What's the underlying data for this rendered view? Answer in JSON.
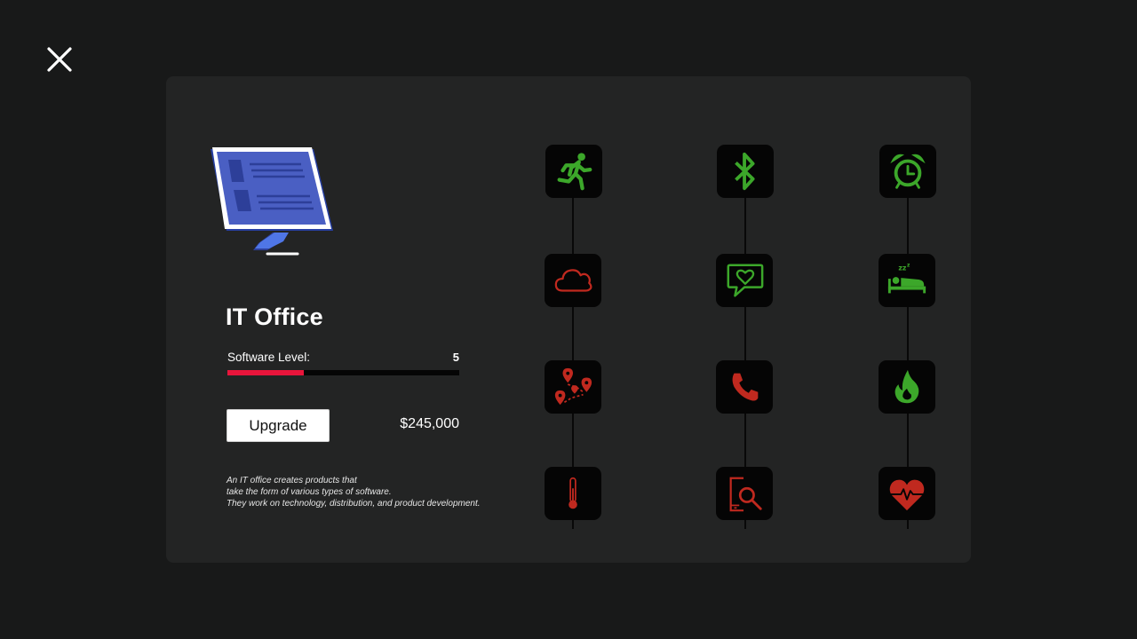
{
  "close": {
    "icon": "close-icon"
  },
  "building": {
    "name": "IT Office",
    "icon": "computer-monitor-icon",
    "level_label": "Software Level:",
    "level_value": "5",
    "level_fraction": 0.33,
    "upgrade_label": "Upgrade",
    "price": "$245,000",
    "description": [
      "An IT office creates products that",
      "take the form of various types of software.",
      "They work on technology, distribution, and product development."
    ]
  },
  "colors": {
    "background": "#181919",
    "panel": "#232424",
    "unlocked": "#3ca72a",
    "locked": "#c0291f",
    "level_fill": "#e8153b"
  },
  "upgrade_tree": [
    {
      "icon": "running-person-icon",
      "status": "unlocked"
    },
    {
      "icon": "cloud-icon",
      "status": "locked"
    },
    {
      "icon": "map-route-icon",
      "status": "locked"
    },
    {
      "icon": "thermometer-icon",
      "status": "locked"
    },
    {
      "icon": "bluetooth-icon",
      "status": "unlocked"
    },
    {
      "icon": "heart-chat-icon",
      "status": "unlocked"
    },
    {
      "icon": "phone-icon",
      "status": "locked"
    },
    {
      "icon": "phone-search-icon",
      "status": "locked"
    },
    {
      "icon": "alarm-clock-icon",
      "status": "unlocked"
    },
    {
      "icon": "sleeping-bed-icon",
      "status": "unlocked"
    },
    {
      "icon": "flame-icon",
      "status": "unlocked"
    },
    {
      "icon": "heartbeat-icon",
      "status": "locked"
    }
  ]
}
